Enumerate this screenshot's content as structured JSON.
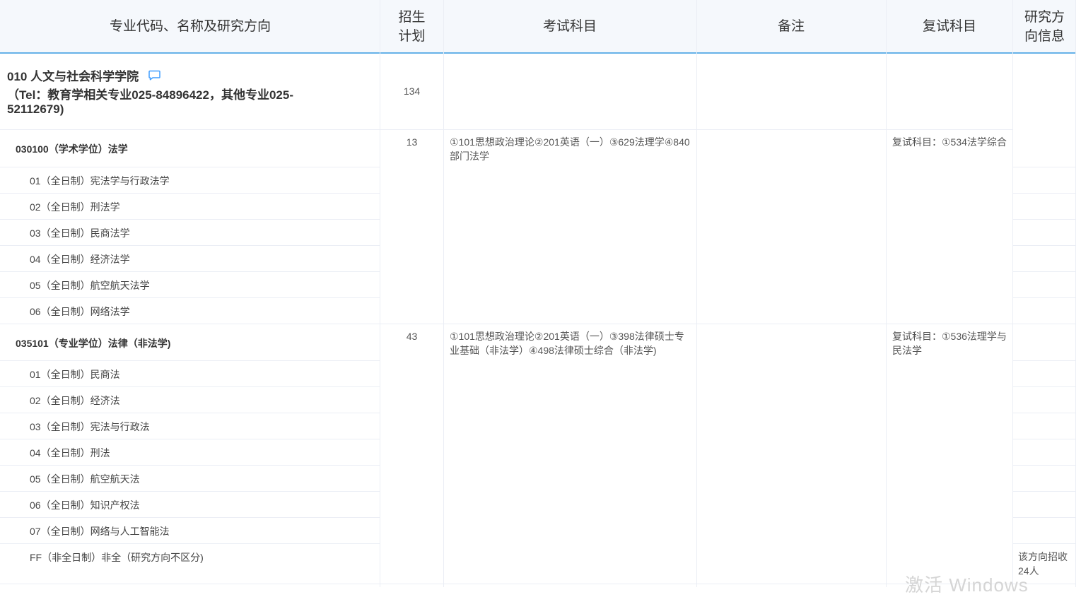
{
  "header": {
    "col_major": "专业代码、名称及研究方向",
    "col_plan_line1": "招生",
    "col_plan_line2": "计划",
    "col_exam": "考试科目",
    "col_remark": "备注",
    "col_retest": "复试科目",
    "col_info_line1": "研究方",
    "col_info_line2": "向信息"
  },
  "college": {
    "title": "010 人文与社会科学学院",
    "tel_line1": "（Tel：教育学相关专业025-84896422，其他专业025-",
    "tel_line2": "52112679)",
    "plan": "134",
    "icon": "comment-icon"
  },
  "majors": [
    {
      "name": "030100（学术学位）法学",
      "plan": "13",
      "exam": "①101思想政治理论②201英语（一）③629法理学④840部门法学",
      "retest": "复试科目：①534法学综合",
      "directions": [
        "01（全日制）宪法学与行政法学",
        "02（全日制）刑法学",
        "03（全日制）民商法学",
        "04（全日制）经济法学",
        "05（全日制）航空航天法学",
        "06（全日制）网络法学"
      ]
    },
    {
      "name": "035101（专业学位）法律（非法学)",
      "plan": "43",
      "exam": "①101思想政治理论②201英语（一）③398法律硕士专业基础（非法学）④498法律硕士综合（非法学)",
      "retest": "复试科目：①536法理学与民法学",
      "directions": [
        "01（全日制）民商法",
        "02（全日制）经济法",
        "03（全日制）宪法与行政法",
        "04（全日制）刑法",
        "05（全日制）航空航天法",
        "06（全日制）知识产权法",
        "07（全日制）网络与人工智能法",
        "FF（非全日制）非全（研究方向不区分)"
      ],
      "last_direction_info": "该方向招收24人"
    }
  ],
  "watermark": "激活 Windows"
}
